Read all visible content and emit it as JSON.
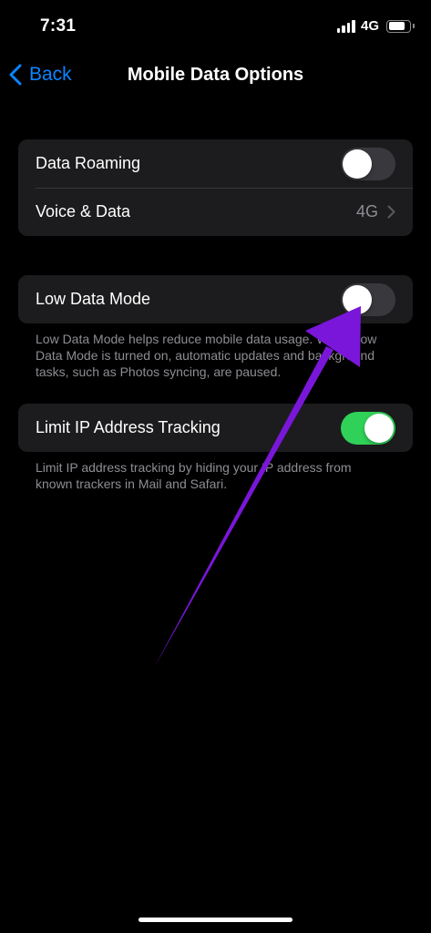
{
  "status_bar": {
    "time": "7:31",
    "network": "4G",
    "signal_bars": 4,
    "battery_icon": "battery-icon",
    "signal_icon": "cellular-signal-icon"
  },
  "nav": {
    "back_label": "Back",
    "back_icon": "chevron-left-icon",
    "title": "Mobile Data Options"
  },
  "group1": {
    "data_roaming": {
      "label": "Data Roaming",
      "on": false
    },
    "voice_data": {
      "label": "Voice & Data",
      "value": "4G",
      "icon": "chevron-right-icon"
    }
  },
  "group2": {
    "low_data_mode": {
      "label": "Low Data Mode",
      "on": false
    },
    "footer": "Low Data Mode helps reduce mobile data usage. When Low Data Mode is turned on, automatic updates and background tasks, such as Photos syncing, are paused."
  },
  "group3": {
    "limit_ip": {
      "label": "Limit IP Address Tracking",
      "on": true
    },
    "footer": "Limit IP address tracking by hiding your IP address from known trackers in Mail and Safari."
  },
  "annotation": {
    "type": "arrow",
    "color": "#7a16d9",
    "points_to": "low-data-mode-toggle"
  },
  "colors": {
    "background": "#000000",
    "cell": "#1c1c1e",
    "accent_blue": "#0a84ff",
    "toggle_on": "#30d158",
    "toggle_off": "#39393d",
    "secondary_text": "#8d8d93"
  }
}
